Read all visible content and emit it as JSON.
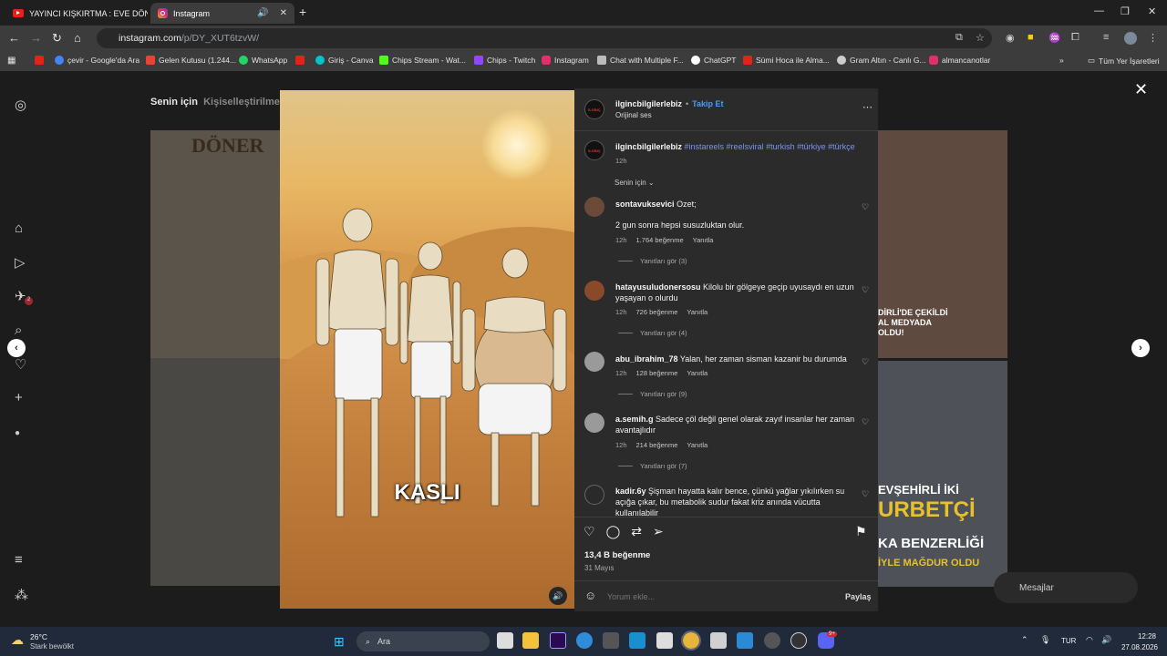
{
  "browser": {
    "tabs": [
      {
        "label": "YAYINCI KIŞKIRTMA : EVE DÖNÜ"
      },
      {
        "label": "Instagram"
      }
    ],
    "url_host": "instagram.com",
    "url_path": "/p/DY_XUT6tzvW/",
    "bookmarks": [
      {
        "label": "çevir - Google'da Ara",
        "color": "#4285f4"
      },
      {
        "label": "Gelen Kutusu (1.244...",
        "color": "#ea4335"
      },
      {
        "label": "WhatsApp",
        "color": "#25d366"
      },
      {
        "label": "Giriş - Canva",
        "color": "#00c4cc"
      },
      {
        "label": "Chips Stream - Wat...",
        "color": "#53fc18"
      },
      {
        "label": "Chips - Twitch",
        "color": "#9146ff"
      },
      {
        "label": "Instagram",
        "color": "#e1306c"
      },
      {
        "label": "Chat with Multiple F...",
        "color": "#bbbbbb"
      },
      {
        "label": "ChatGPT",
        "color": "#ffffff"
      },
      {
        "label": "Sümi Hoca ile Alma...",
        "color": "#e62117"
      },
      {
        "label": "Gram Altın - Canlı G...",
        "color": "#cccccc"
      },
      {
        "label": "almancanotlar",
        "color": "#e1306c"
      }
    ],
    "all_bookmarks": "Tüm Yer İşaretleri"
  },
  "instagram": {
    "feed_tabs": {
      "active": "Senin için",
      "other": "Kişiselleştirilmeme"
    },
    "bg_texts": {
      "doner": "DÖNER",
      "right1": "DİRLİ'DE ÇEKİLDİ",
      "right2": "AL MEDYADA",
      "right3": "OLDU!",
      "right4": "EVŞEHİRLİ İKİ",
      "right5": "URBETÇİ",
      "right6": "KA BENZERLİĞİ",
      "right7": "İYLE MAĞDUR OLDU"
    },
    "video": {
      "caption_overlay": "KASLI"
    },
    "post": {
      "author": "ilgincbilgilerlebiz",
      "follow": "Takip Et",
      "audio": "Orijinal ses",
      "caption_tags": "#instareels #reelsviral #turkish #türkiye #türkçe",
      "caption_time": "12h",
      "sort": "Senin için",
      "comments": [
        {
          "user": "sontavuksevici",
          "text": "Ozet;",
          "text2": "2 gun sonra hepsi susuzluktan olur.",
          "time": "12h",
          "likes": "1.764 beğenme",
          "reply": "Yanıtla",
          "replies": "Yanıtları gör (3)"
        },
        {
          "user": "hatayusuludonersosu",
          "text": "Kilolu bir gölgeye geçip uyusaydı en uzun yaşayan o olurdu",
          "time": "12h",
          "likes": "726 beğenme",
          "reply": "Yanıtla",
          "replies": "Yanıtları gör (4)"
        },
        {
          "user": "abu_ibrahim_78",
          "text": "Yalan, her zaman sisman kazanir bu durumda",
          "time": "12h",
          "likes": "128 beğenme",
          "reply": "Yanıtla",
          "replies": "Yanıtları gör (9)"
        },
        {
          "user": "a.semih.g",
          "text": "Sadece çöl değil genel olarak zayıf insanlar her zaman avantajlıdır",
          "time": "12h",
          "likes": "214 beğenme",
          "reply": "Yanıtla",
          "replies": "Yanıtları gör (7)"
        },
        {
          "user": "kadir.6y",
          "text": "Şişman hayatta kalır bence, çünkü yağlar yıkılırken su açığa çıkar, bu metabolik sudur fakat kriz anında vücutta kullanılabilir"
        }
      ],
      "likes": "13,4 B beğenme",
      "date": "31 Mayıs",
      "comment_placeholder": "Yorum ekle...",
      "share": "Paylaş"
    },
    "messages": "Mesajlar",
    "notif_count": "2"
  },
  "taskbar": {
    "weather_temp": "26°C",
    "weather_desc": "Stark bewölkt",
    "search": "Ara",
    "lang": "TUR",
    "time": "12:28",
    "date": "27.08.2026",
    "discord_badge": "9+"
  }
}
